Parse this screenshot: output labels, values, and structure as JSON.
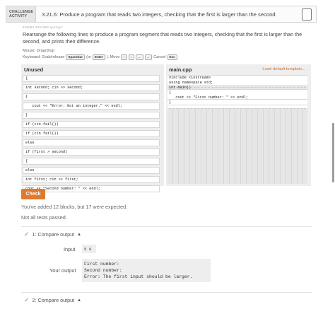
{
  "header": {
    "badge_line1": "CHALLENGE",
    "badge_line2": "ACTIVITY",
    "title": "3.21.6: Produce a program that reads two integers, checking that the first is larger than the second."
  },
  "activity_id": "408684.2991960.qx3zqy7",
  "instructions": "Rearrange the following lines to produce a program segment that reads two integers, checking that the first is larger than the second, and prints their difference.",
  "controls": {
    "mouse": "Mouse: Drag/drop",
    "kbd_prefix": "Keyboard: Grab/release",
    "kbd_space": "Spacebar",
    "kbd_or": "(or",
    "kbd_enter": "Enter",
    "kbd_move": "). Move",
    "kbd_up": "↑",
    "kbd_down": "↓",
    "kbd_left": "←",
    "kbd_right": "→",
    "kbd_cancel": "Cancel",
    "kbd_esc": "Esc"
  },
  "unused": {
    "title": "Unused",
    "blocks": [
      "{",
      "int second; cin >> second;",
      "{",
      "   cout << \"Error: Not an integer.\" << endl;",
      "}",
      "if (cin.fail())",
      "if (cin.fail())",
      "else",
      "if (first > second)",
      "{",
      "else",
      "int first; cin >> first;",
      "cout << \"Second number: \" << endl;"
    ]
  },
  "main_cpp": {
    "title": "main.cpp",
    "load_link": "Load default template...",
    "code": [
      "#include <iostream>",
      "using namespace std;",
      "",
      "int main()",
      "{",
      "   cout << \"First number: \" << endl;",
      "}"
    ]
  },
  "check_label": "Check",
  "messages": {
    "blocks_msg": "You've added 12 blocks, but 17 were expected.",
    "tests_msg": "Not all tests passed."
  },
  "tests": {
    "section1_title": "1: Compare output",
    "input_label": "Input",
    "input_value": "5 9",
    "output_label": "Your output",
    "output_lines": [
      "First number:",
      "Second number:",
      "Error: The first input should be larger."
    ],
    "section2_title": "2: Compare output"
  },
  "colors": {
    "accent": "#e07a2e",
    "pass_tick": "#6aa34a"
  }
}
